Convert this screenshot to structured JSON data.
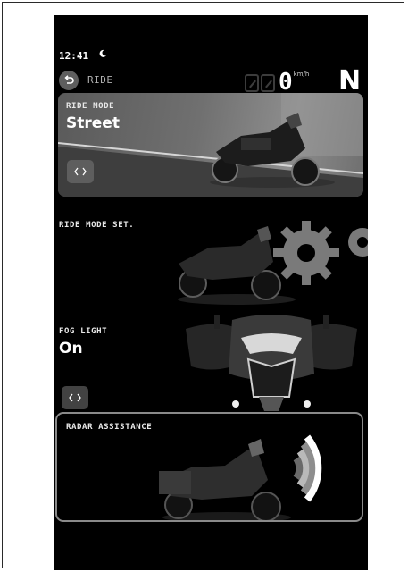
{
  "status": {
    "time": "12:41"
  },
  "header": {
    "title": "RIDE",
    "speed": "0",
    "speed_unit": "km/h",
    "gear": "N"
  },
  "cards": {
    "ride_mode": {
      "label": "RIDE MODE",
      "value": "Street"
    },
    "ride_mode_set": {
      "label": "RIDE MODE SET."
    },
    "fog_light": {
      "label": "FOG LIGHT",
      "value": "On"
    },
    "radar": {
      "label": "RADAR ASSISTANCE"
    }
  },
  "icons": [
    "back-icon",
    "moon-icon",
    "chevron-left-right-icon",
    "gear-icon",
    "radar-waves-icon"
  ],
  "colors": {
    "background": "#000000",
    "accent_white": "#ffffff",
    "card_border": "#8a8a8a"
  }
}
